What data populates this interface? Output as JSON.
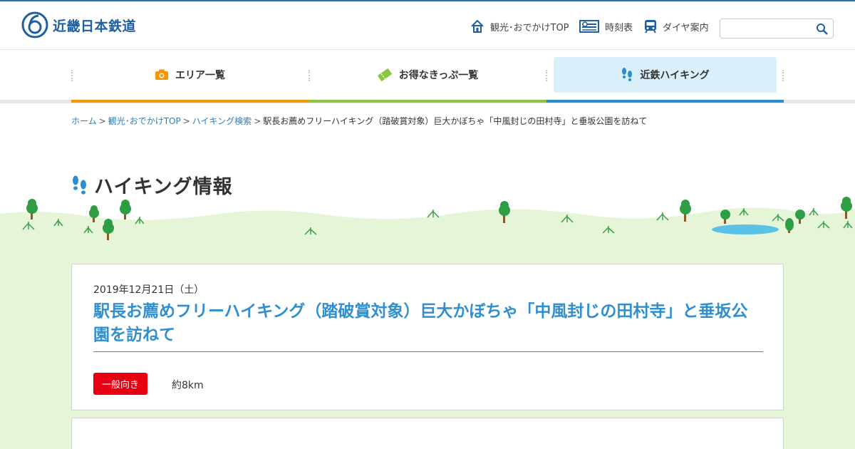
{
  "header": {
    "logo_text": "近畿日本鉄道",
    "nav": [
      {
        "label": "観光･おでかけTOP",
        "icon": "home-icon"
      },
      {
        "label": "時刻表",
        "icon": "timetable-icon"
      },
      {
        "label": "ダイヤ案内",
        "icon": "train-icon"
      }
    ],
    "search": {
      "placeholder": "",
      "icon": "search-icon"
    }
  },
  "global_nav": {
    "tabs": [
      {
        "label": "エリア一覧",
        "icon": "camera-icon",
        "color": "#f39800"
      },
      {
        "label": "お得なきっぷ一覧",
        "icon": "ticket-icon",
        "color": "#8cc63f"
      },
      {
        "label": "近鉄ハイキング",
        "icon": "footprints-icon",
        "color": "#2a8fd0",
        "active": true
      }
    ]
  },
  "breadcrumb": {
    "items": [
      "ホーム",
      "観光･おでかけTOP",
      "ハイキング検索"
    ],
    "separator": ">",
    "current": "駅長お薦めフリーハイキング（踏破賞対象）巨大かぼちゃ「中風封じの田村寺」と垂坂公園を訪ねて"
  },
  "page": {
    "title": "ハイキング情報"
  },
  "event": {
    "date": "2019年12月21日（土）",
    "title": "駅長お薦めフリーハイキング（踏破賞対象）巨大かぼちゃ「中風封じの田村寺」と垂坂公園を訪ねて",
    "level_badge": "一般向き",
    "distance": "約8km"
  },
  "colors": {
    "brand": "#1f5fa0",
    "accent": "#2f8fcf",
    "badge": "#e60012",
    "grass": "#e6f4d8"
  }
}
